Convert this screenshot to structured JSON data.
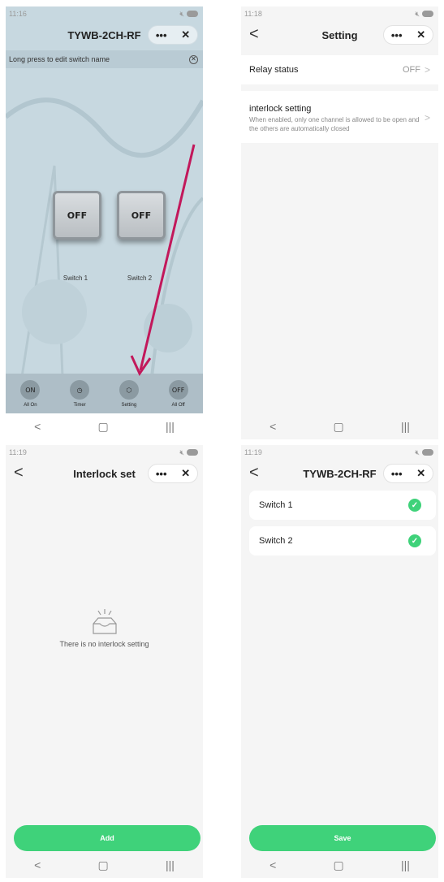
{
  "screen1": {
    "time": "11:16",
    "title": "TYWB-2CH-RF",
    "tip": "Long press to edit switch name",
    "switches": [
      {
        "state": "OFF",
        "name": "Switch 1"
      },
      {
        "state": "OFF",
        "name": "Switch 2"
      }
    ],
    "bottom": [
      {
        "icon_text": "ON",
        "label": "All On",
        "icon": "on-icon"
      },
      {
        "icon_text": "◷",
        "label": "Timer",
        "icon": "clock-icon"
      },
      {
        "icon_text": "⬡",
        "label": "Setting",
        "icon": "cube-icon"
      },
      {
        "icon_text": "OFF",
        "label": "All Off",
        "icon": "off-icon"
      }
    ]
  },
  "screen2": {
    "time": "11:18",
    "title": "Setting",
    "relay_label": "Relay status",
    "relay_value": "OFF",
    "interlock_label": "interlock setting",
    "interlock_desc": "When enabled, only one channel is allowed to be open and the others are automatically closed"
  },
  "screen3": {
    "time": "11:19",
    "title": "Interlock set",
    "empty_text": "There is no interlock setting",
    "add_label": "Add"
  },
  "screen4": {
    "time": "11:19",
    "title": "TYWB-2CH-RF",
    "items": [
      "Switch 1",
      "Switch 2"
    ],
    "save_label": "Save"
  },
  "capsule": {
    "more": "•••",
    "close": "✕"
  },
  "nav": {
    "back": "<",
    "home": "▢",
    "recents": "|||"
  },
  "colors": {
    "accent_green": "#3fd27a",
    "annotation_arrow": "#c2185b"
  }
}
